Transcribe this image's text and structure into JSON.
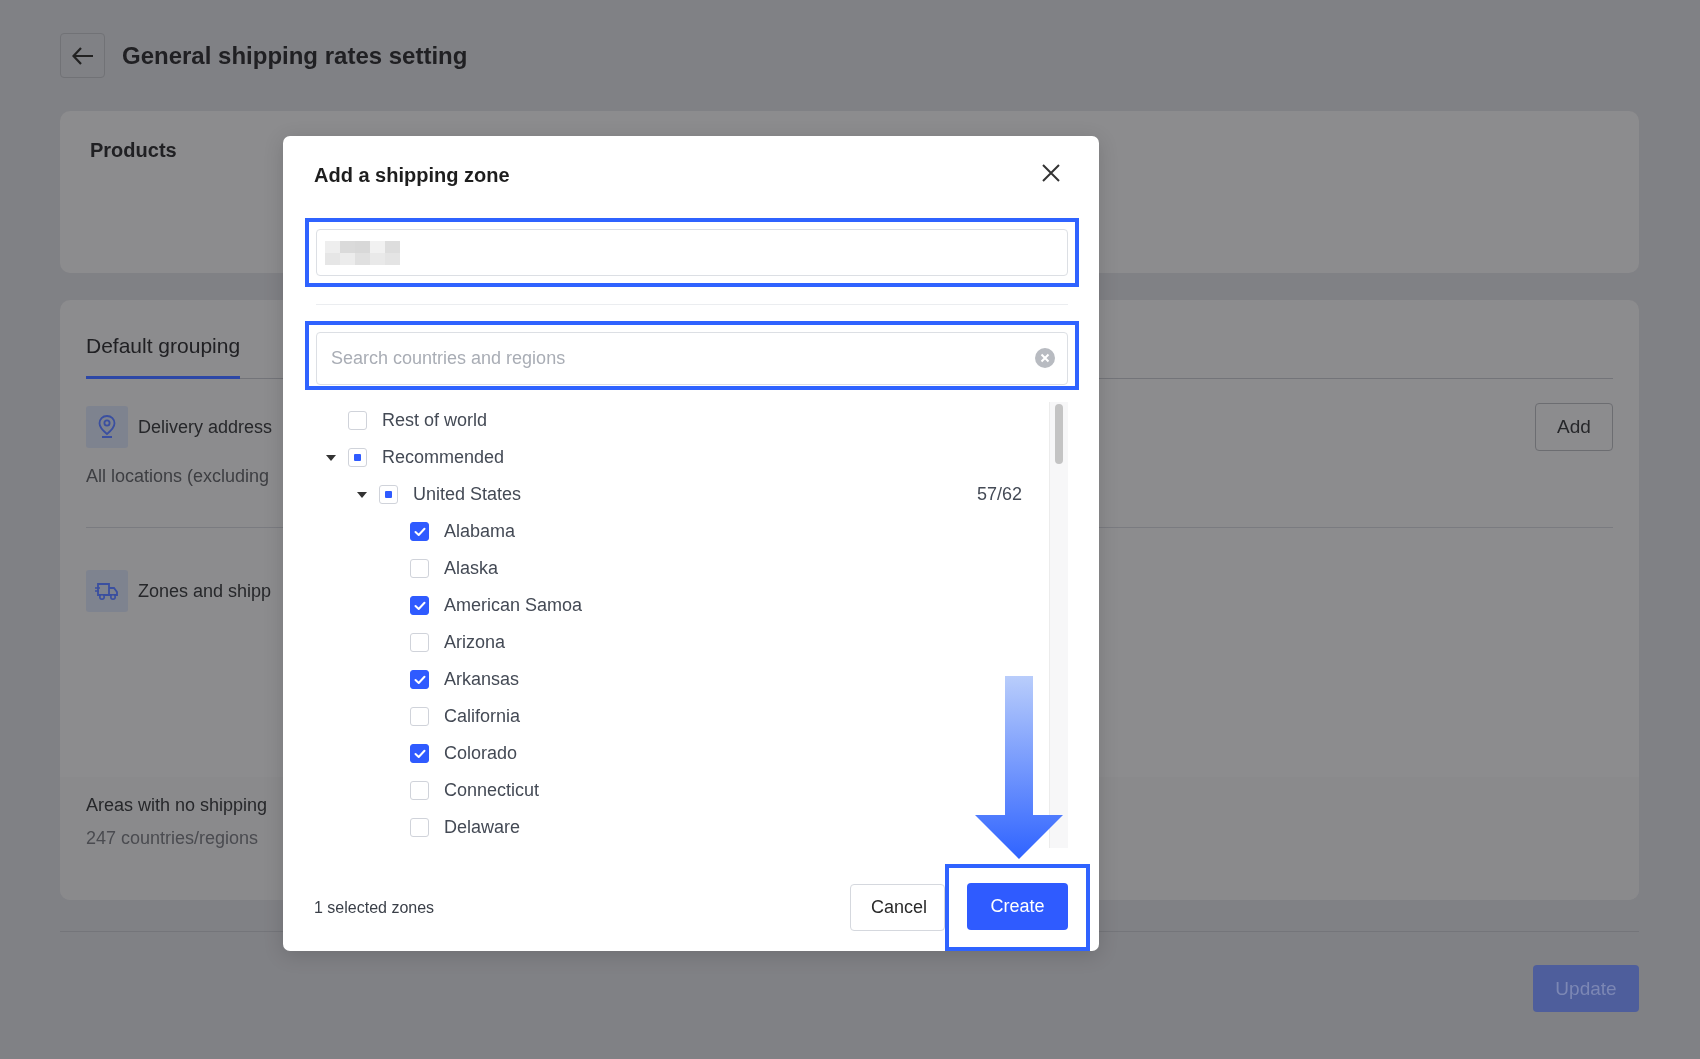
{
  "page": {
    "title": "General shipping rates setting",
    "update_button": "Update"
  },
  "products_card": {
    "title": "Products"
  },
  "grouping_card": {
    "tabs": [
      {
        "label": "Default grouping",
        "selected": true
      }
    ],
    "delivery": {
      "label": "Delivery address",
      "detail": "All locations (excluding"
    },
    "add_button": "Add",
    "zones": {
      "label": "Zones and shipp"
    },
    "no_shipping": {
      "label": "Areas with no shipping",
      "count": "247 countries/regions"
    }
  },
  "dialog": {
    "title": "Add a shipping zone",
    "search": {
      "placeholder": "Search countries and regions"
    },
    "tree": [
      {
        "label": "Rest of world",
        "checked": false
      },
      {
        "label": "Recommended",
        "indeterminate": true,
        "expanded": true,
        "children": [
          {
            "label": "United States",
            "indeterminate": true,
            "expanded": true,
            "count": "57/62",
            "children": [
              {
                "label": "Alabama",
                "checked": true
              },
              {
                "label": "Alaska",
                "checked": false
              },
              {
                "label": "American Samoa",
                "checked": true
              },
              {
                "label": "Arizona",
                "checked": false
              },
              {
                "label": "Arkansas",
                "checked": true
              },
              {
                "label": "California",
                "checked": false
              },
              {
                "label": "Colorado",
                "checked": true
              },
              {
                "label": "Connecticut",
                "checked": false
              },
              {
                "label": "Delaware",
                "checked": false
              }
            ]
          }
        ]
      }
    ],
    "selection_summary": "1 selected zones",
    "cancel_button": "Cancel",
    "create_button": "Create"
  }
}
